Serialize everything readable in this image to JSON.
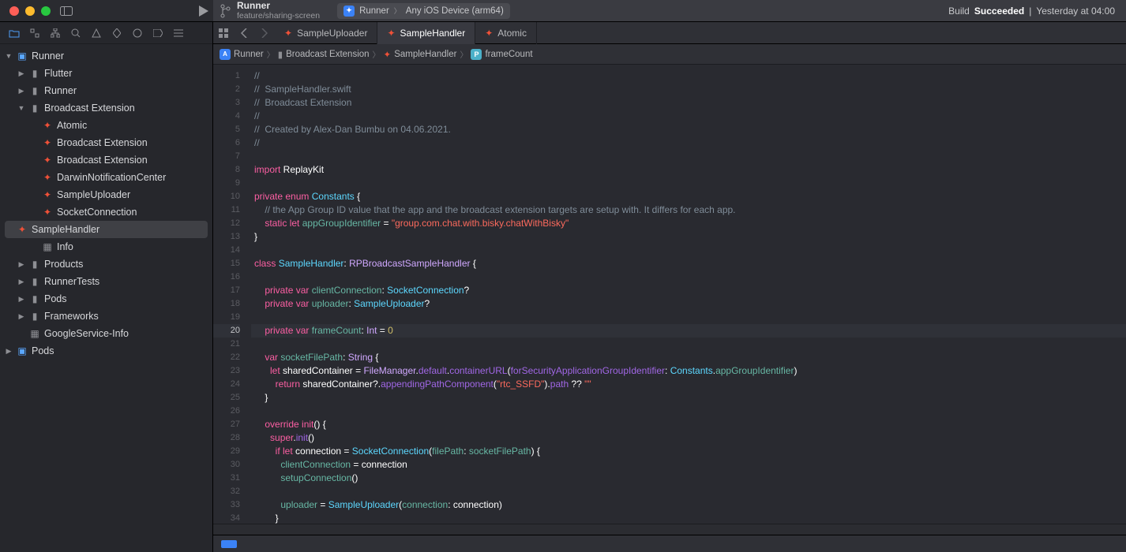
{
  "window": {
    "project_name": "Runner",
    "branch_name": "feature/sharing-screen",
    "scheme": "Runner",
    "destination": "Any iOS Device (arm64)",
    "build_status_prefix": "Build",
    "build_status_word": "Succeeded",
    "build_status_time": "Yesterday at 04:00"
  },
  "tabs": [
    {
      "label": "SampleUploader",
      "active": false
    },
    {
      "label": "SampleHandler",
      "active": true
    },
    {
      "label": "Atomic",
      "active": false
    }
  ],
  "jumpbar": {
    "project": "Runner",
    "folder": "Broadcast Extension",
    "file": "SampleHandler",
    "symbol": "frameCount"
  },
  "navigator": [
    {
      "depth": 0,
      "disclosure": "down",
      "icon": "proj",
      "label": "Runner"
    },
    {
      "depth": 1,
      "disclosure": "right",
      "icon": "fold",
      "label": "Flutter"
    },
    {
      "depth": 1,
      "disclosure": "right",
      "icon": "fold",
      "label": "Runner"
    },
    {
      "depth": 1,
      "disclosure": "down",
      "icon": "fold",
      "label": "Broadcast Extension"
    },
    {
      "depth": 2,
      "disclosure": "",
      "icon": "swift",
      "label": "Atomic"
    },
    {
      "depth": 2,
      "disclosure": "",
      "icon": "swift",
      "label": "Broadcast Extension"
    },
    {
      "depth": 2,
      "disclosure": "",
      "icon": "swift",
      "label": "Broadcast Extension"
    },
    {
      "depth": 2,
      "disclosure": "",
      "icon": "swift",
      "label": "DarwinNotificationCenter"
    },
    {
      "depth": 2,
      "disclosure": "",
      "icon": "swift",
      "label": "SampleUploader"
    },
    {
      "depth": 2,
      "disclosure": "",
      "icon": "swift",
      "label": "SocketConnection"
    },
    {
      "depth": 2,
      "disclosure": "",
      "icon": "swift",
      "label": "SampleHandler",
      "selected": true
    },
    {
      "depth": 2,
      "disclosure": "",
      "icon": "plist",
      "label": "Info"
    },
    {
      "depth": 1,
      "disclosure": "right",
      "icon": "fold",
      "label": "Products"
    },
    {
      "depth": 1,
      "disclosure": "right",
      "icon": "fold",
      "label": "RunnerTests"
    },
    {
      "depth": 1,
      "disclosure": "right",
      "icon": "fold",
      "label": "Pods"
    },
    {
      "depth": 1,
      "disclosure": "right",
      "icon": "fold",
      "label": "Frameworks"
    },
    {
      "depth": 1,
      "disclosure": "",
      "icon": "plist",
      "label": "GoogleService-Info"
    },
    {
      "depth": 0,
      "disclosure": "right",
      "icon": "proj",
      "label": "Pods"
    }
  ],
  "code": {
    "highlighted_line": 20,
    "lines": [
      [
        {
          "t": "//",
          "c": "comment"
        }
      ],
      [
        {
          "t": "//  SampleHandler.swift",
          "c": "comment"
        }
      ],
      [
        {
          "t": "//  Broadcast Extension",
          "c": "comment"
        }
      ],
      [
        {
          "t": "//",
          "c": "comment"
        }
      ],
      [
        {
          "t": "//  Created by Alex-Dan Bumbu on 04.06.2021.",
          "c": "comment"
        }
      ],
      [
        {
          "t": "//",
          "c": "comment"
        }
      ],
      [],
      [
        {
          "t": "import",
          "c": "keyword"
        },
        {
          "t": " ReplayKit",
          "c": "plain"
        }
      ],
      [],
      [
        {
          "t": "private",
          "c": "keyword"
        },
        {
          "t": " ",
          "c": "plain"
        },
        {
          "t": "enum",
          "c": "keyword"
        },
        {
          "t": " ",
          "c": "plain"
        },
        {
          "t": "Constants",
          "c": "type"
        },
        {
          "t": " {",
          "c": "plain"
        }
      ],
      [
        {
          "t": "    ",
          "c": "plain"
        },
        {
          "t": "// the App Group ID value that the app and the broadcast extension targets are setup with. It differs for each app.",
          "c": "comment"
        }
      ],
      [
        {
          "t": "    ",
          "c": "plain"
        },
        {
          "t": "static",
          "c": "keyword"
        },
        {
          "t": " ",
          "c": "plain"
        },
        {
          "t": "let",
          "c": "keyword"
        },
        {
          "t": " ",
          "c": "plain"
        },
        {
          "t": "appGroupIdentifier",
          "c": "prop"
        },
        {
          "t": " = ",
          "c": "plain"
        },
        {
          "t": "\"group.com.chat.with.bisky.chatWithBisky\"",
          "c": "string"
        }
      ],
      [
        {
          "t": "}",
          "c": "plain"
        }
      ],
      [],
      [
        {
          "t": "class",
          "c": "keyword"
        },
        {
          "t": " ",
          "c": "plain"
        },
        {
          "t": "SampleHandler",
          "c": "type"
        },
        {
          "t": ": ",
          "c": "plain"
        },
        {
          "t": "RPBroadcastSampleHandler",
          "c": "systype"
        },
        {
          "t": " {",
          "c": "plain"
        }
      ],
      [],
      [
        {
          "t": "    ",
          "c": "plain"
        },
        {
          "t": "private",
          "c": "keyword"
        },
        {
          "t": " ",
          "c": "plain"
        },
        {
          "t": "var",
          "c": "keyword"
        },
        {
          "t": " ",
          "c": "plain"
        },
        {
          "t": "clientConnection",
          "c": "prop"
        },
        {
          "t": ": ",
          "c": "plain"
        },
        {
          "t": "SocketConnection",
          "c": "type"
        },
        {
          "t": "?",
          "c": "plain"
        }
      ],
      [
        {
          "t": "    ",
          "c": "plain"
        },
        {
          "t": "private",
          "c": "keyword"
        },
        {
          "t": " ",
          "c": "plain"
        },
        {
          "t": "var",
          "c": "keyword"
        },
        {
          "t": " ",
          "c": "plain"
        },
        {
          "t": "uploader",
          "c": "prop"
        },
        {
          "t": ": ",
          "c": "plain"
        },
        {
          "t": "SampleUploader",
          "c": "type"
        },
        {
          "t": "?",
          "c": "plain"
        }
      ],
      [],
      [
        {
          "t": "    ",
          "c": "plain"
        },
        {
          "t": "private",
          "c": "keyword"
        },
        {
          "t": " ",
          "c": "plain"
        },
        {
          "t": "var",
          "c": "keyword"
        },
        {
          "t": " ",
          "c": "plain"
        },
        {
          "t": "frameCount",
          "c": "prop"
        },
        {
          "t": ": ",
          "c": "plain"
        },
        {
          "t": "Int",
          "c": "systype"
        },
        {
          "t": " = ",
          "c": "plain"
        },
        {
          "t": "0",
          "c": "number"
        }
      ],
      [],
      [
        {
          "t": "    ",
          "c": "plain"
        },
        {
          "t": "var",
          "c": "keyword"
        },
        {
          "t": " ",
          "c": "plain"
        },
        {
          "t": "socketFilePath",
          "c": "prop"
        },
        {
          "t": ": ",
          "c": "plain"
        },
        {
          "t": "String",
          "c": "systype"
        },
        {
          "t": " {",
          "c": "plain"
        }
      ],
      [
        {
          "t": "      ",
          "c": "plain"
        },
        {
          "t": "let",
          "c": "keyword"
        },
        {
          "t": " sharedContainer = ",
          "c": "plain"
        },
        {
          "t": "FileManager",
          "c": "systype"
        },
        {
          "t": ".",
          "c": "plain"
        },
        {
          "t": "default",
          "c": "func"
        },
        {
          "t": ".",
          "c": "plain"
        },
        {
          "t": "containerURL",
          "c": "func"
        },
        {
          "t": "(",
          "c": "plain"
        },
        {
          "t": "forSecurityApplicationGroupIdentifier",
          "c": "func"
        },
        {
          "t": ": ",
          "c": "plain"
        },
        {
          "t": "Constants",
          "c": "type"
        },
        {
          "t": ".",
          "c": "plain"
        },
        {
          "t": "appGroupIdentifier",
          "c": "prop"
        },
        {
          "t": ")",
          "c": "plain"
        }
      ],
      [
        {
          "t": "        ",
          "c": "plain"
        },
        {
          "t": "return",
          "c": "keyword"
        },
        {
          "t": " sharedContainer?.",
          "c": "plain"
        },
        {
          "t": "appendingPathComponent",
          "c": "func"
        },
        {
          "t": "(",
          "c": "plain"
        },
        {
          "t": "\"rtc_SSFD\"",
          "c": "string"
        },
        {
          "t": ").",
          "c": "plain"
        },
        {
          "t": "path",
          "c": "func"
        },
        {
          "t": " ?? ",
          "c": "plain"
        },
        {
          "t": "\"\"",
          "c": "string"
        }
      ],
      [
        {
          "t": "    }",
          "c": "plain"
        }
      ],
      [],
      [
        {
          "t": "    ",
          "c": "plain"
        },
        {
          "t": "override",
          "c": "keyword"
        },
        {
          "t": " ",
          "c": "plain"
        },
        {
          "t": "init",
          "c": "keyword"
        },
        {
          "t": "() {",
          "c": "plain"
        }
      ],
      [
        {
          "t": "      ",
          "c": "plain"
        },
        {
          "t": "super",
          "c": "keyword"
        },
        {
          "t": ".",
          "c": "plain"
        },
        {
          "t": "init",
          "c": "func"
        },
        {
          "t": "()",
          "c": "plain"
        }
      ],
      [
        {
          "t": "        ",
          "c": "plain"
        },
        {
          "t": "if",
          "c": "keyword"
        },
        {
          "t": " ",
          "c": "plain"
        },
        {
          "t": "let",
          "c": "keyword"
        },
        {
          "t": " connection = ",
          "c": "plain"
        },
        {
          "t": "SocketConnection",
          "c": "type"
        },
        {
          "t": "(",
          "c": "plain"
        },
        {
          "t": "filePath",
          "c": "method"
        },
        {
          "t": ": ",
          "c": "plain"
        },
        {
          "t": "socketFilePath",
          "c": "prop"
        },
        {
          "t": ") {",
          "c": "plain"
        }
      ],
      [
        {
          "t": "          ",
          "c": "plain"
        },
        {
          "t": "clientConnection",
          "c": "prop"
        },
        {
          "t": " = connection",
          "c": "plain"
        }
      ],
      [
        {
          "t": "          ",
          "c": "plain"
        },
        {
          "t": "setupConnection",
          "c": "method"
        },
        {
          "t": "()",
          "c": "plain"
        }
      ],
      [],
      [
        {
          "t": "          ",
          "c": "plain"
        },
        {
          "t": "uploader",
          "c": "prop"
        },
        {
          "t": " = ",
          "c": "plain"
        },
        {
          "t": "SampleUploader",
          "c": "type"
        },
        {
          "t": "(",
          "c": "plain"
        },
        {
          "t": "connection",
          "c": "method"
        },
        {
          "t": ": connection)",
          "c": "plain"
        }
      ],
      [
        {
          "t": "        }",
          "c": "plain"
        }
      ]
    ]
  }
}
